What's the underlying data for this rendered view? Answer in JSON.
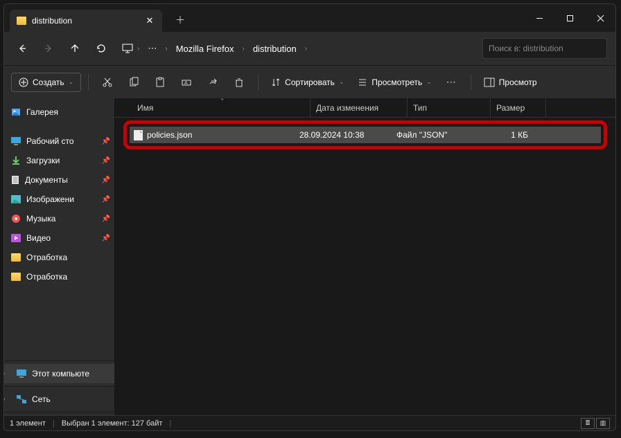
{
  "tab": {
    "title": "distribution"
  },
  "nav": {
    "crumb_root_icon": "monitor",
    "crumb_ellipsis": "⋯",
    "crumb1": "Mozilla Firefox",
    "crumb2": "distribution",
    "search_placeholder": "Поиск в: distribution"
  },
  "toolbar": {
    "create": "Создать",
    "sort": "Сортировать",
    "view": "Просмотреть",
    "preview": "Просмотр"
  },
  "headers": {
    "name": "Имя",
    "date": "Дата изменения",
    "type": "Тип",
    "size": "Размер"
  },
  "sidebar": {
    "gallery": "Галерея",
    "desktop": "Рабочий сто",
    "downloads": "Загрузки",
    "documents": "Документы",
    "pictures": "Изображени",
    "music": "Музыка",
    "videos": "Видео",
    "folder1": "Отработка",
    "folder2": "Отработка",
    "thispc": "Этот компьюте",
    "network": "Сеть"
  },
  "file": {
    "name": "policies.json",
    "date": "28.09.2024 10:38",
    "type": "Файл \"JSON\"",
    "size": "1 КБ"
  },
  "status": {
    "count": "1 элемент",
    "selected": "Выбран 1 элемент: 127 байт"
  }
}
